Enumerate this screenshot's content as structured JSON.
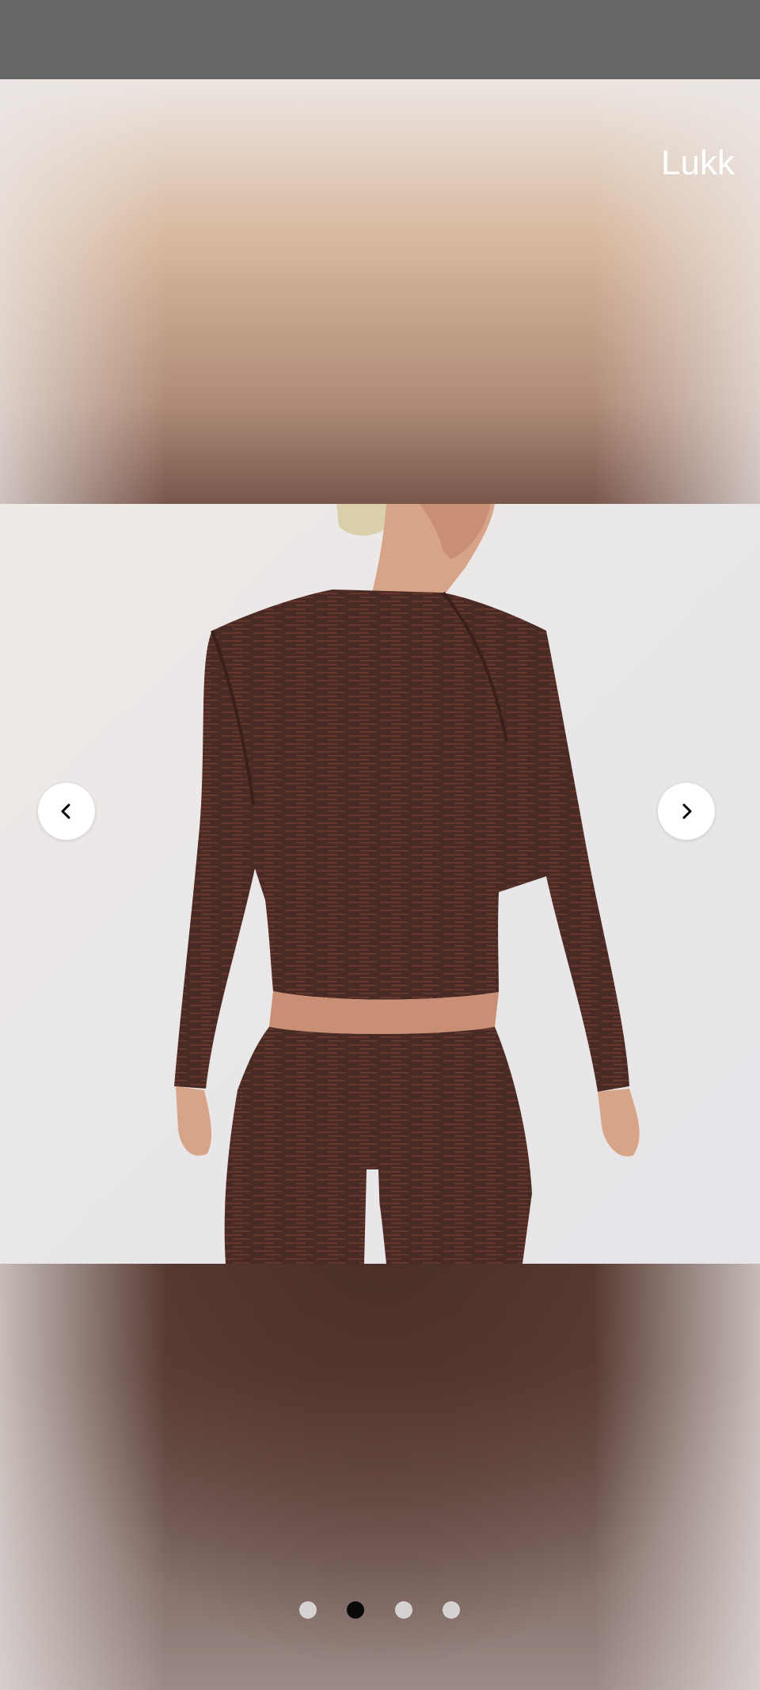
{
  "viewer": {
    "close_label": "Lukk",
    "prev_icon": "chevron-left-icon",
    "next_icon": "chevron-right-icon",
    "image_icon": "product-photo",
    "total_images": 4,
    "active_index": 1
  },
  "colors": {
    "status_bar": "#666666",
    "dot_active": "#0a0a0a",
    "dot_inactive": "#d6d2d2",
    "garment": "#4e2c26"
  }
}
